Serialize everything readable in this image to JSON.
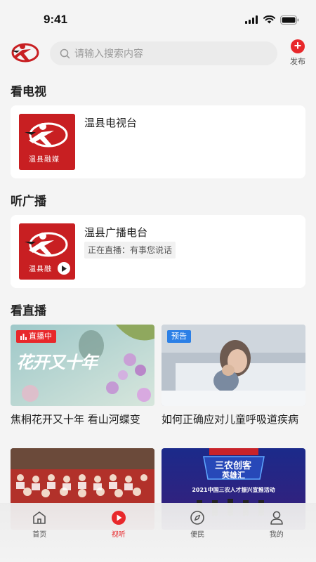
{
  "status": {
    "time": "9:41"
  },
  "search": {
    "placeholder": "请输入搜索内容"
  },
  "header": {
    "publish_label": "发布"
  },
  "tv": {
    "section_title": "看电视",
    "station_name": "温县电视台",
    "thumb_text": "温县融媒"
  },
  "radio": {
    "section_title": "听广播",
    "station_name": "温县广播电台",
    "live_text": "正在直播：有事您说话",
    "thumb_text": "温县融"
  },
  "live": {
    "section_title": "看直播",
    "items": [
      {
        "title": "焦桐花开又十年 看山河蝶变",
        "badge": "直播中",
        "poster_text": "花开又十年"
      },
      {
        "title": "如何正确应对儿童呼吸道疾病",
        "badge": "预告"
      },
      {
        "title": ""
      },
      {
        "title": "",
        "poster_line1": "三农创客",
        "poster_line2": "英雄汇",
        "poster_caption": "2021中国三农人才振兴宣推活动"
      }
    ]
  },
  "tabs": [
    {
      "label": "首页",
      "icon": "home-icon",
      "active": false
    },
    {
      "label": "视听",
      "icon": "play-icon",
      "active": true
    },
    {
      "label": "便民",
      "icon": "compass-icon",
      "active": false
    },
    {
      "label": "我的",
      "icon": "user-icon",
      "active": false
    }
  ],
  "colors": {
    "accent": "#e8282b",
    "preview": "#2b7fe6",
    "background": "#f4f4f4"
  }
}
